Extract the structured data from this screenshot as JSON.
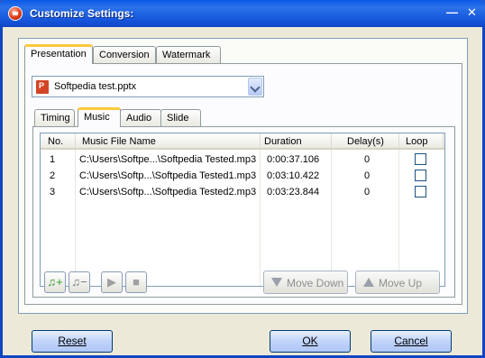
{
  "window": {
    "title": "Customize Settings:",
    "minimize_glyph": "—",
    "close_glyph": "✕"
  },
  "main_tabs": [
    "Presentation",
    "Conversion",
    "Watermark"
  ],
  "file_select": {
    "value": "Softpedia test.pptx",
    "icon": "powerpoint-file-icon"
  },
  "sub_tabs": [
    "Timing",
    "Music",
    "Audio",
    "Slide"
  ],
  "music_list": {
    "columns": [
      "No.",
      "Music File Name",
      "Duration",
      "Delay(s)",
      "Loop"
    ],
    "rows": [
      {
        "no": "1",
        "file": "C:\\Users\\Softpe...\\Softpedia Tested.mp3",
        "duration": "0:00:37.106",
        "delay": "0",
        "loop": false
      },
      {
        "no": "2",
        "file": "C:\\Users\\Softp...\\Softpedia Tested1.mp3",
        "duration": "0:03:10.422",
        "delay": "0",
        "loop": false
      },
      {
        "no": "3",
        "file": "C:\\Users\\Softp...\\Softpedia Tested2.mp3",
        "duration": "0:03:23.844",
        "delay": "0",
        "loop": false
      }
    ]
  },
  "toolbar": {
    "add_music_icon": "music-add-icon",
    "remove_music_icon": "music-remove-icon",
    "play_icon": "play-icon",
    "stop_icon": "stop-icon",
    "move_down_label": "Move Down",
    "move_up_label": "Move Up"
  },
  "buttons": {
    "reset_label": "Reset",
    "ok_label": "OK",
    "cancel_label": "Cancel"
  },
  "colors": {
    "titlebar": "#0a5ae6",
    "active_tab_accent": "#ffc83c",
    "dialog_bg": "#ece9d8"
  }
}
